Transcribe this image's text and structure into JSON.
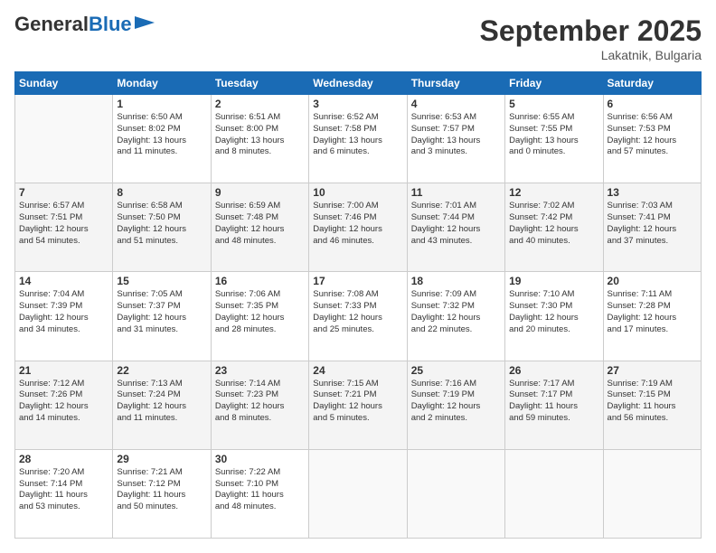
{
  "header": {
    "logo_general": "General",
    "logo_blue": "Blue",
    "month_title": "September 2025",
    "subtitle": "Lakatnik, Bulgaria"
  },
  "weekdays": [
    "Sunday",
    "Monday",
    "Tuesday",
    "Wednesday",
    "Thursday",
    "Friday",
    "Saturday"
  ],
  "weeks": [
    [
      {
        "day": "",
        "info": ""
      },
      {
        "day": "1",
        "info": "Sunrise: 6:50 AM\nSunset: 8:02 PM\nDaylight: 13 hours\nand 11 minutes."
      },
      {
        "day": "2",
        "info": "Sunrise: 6:51 AM\nSunset: 8:00 PM\nDaylight: 13 hours\nand 8 minutes."
      },
      {
        "day": "3",
        "info": "Sunrise: 6:52 AM\nSunset: 7:58 PM\nDaylight: 13 hours\nand 6 minutes."
      },
      {
        "day": "4",
        "info": "Sunrise: 6:53 AM\nSunset: 7:57 PM\nDaylight: 13 hours\nand 3 minutes."
      },
      {
        "day": "5",
        "info": "Sunrise: 6:55 AM\nSunset: 7:55 PM\nDaylight: 13 hours\nand 0 minutes."
      },
      {
        "day": "6",
        "info": "Sunrise: 6:56 AM\nSunset: 7:53 PM\nDaylight: 12 hours\nand 57 minutes."
      }
    ],
    [
      {
        "day": "7",
        "info": "Sunrise: 6:57 AM\nSunset: 7:51 PM\nDaylight: 12 hours\nand 54 minutes."
      },
      {
        "day": "8",
        "info": "Sunrise: 6:58 AM\nSunset: 7:50 PM\nDaylight: 12 hours\nand 51 minutes."
      },
      {
        "day": "9",
        "info": "Sunrise: 6:59 AM\nSunset: 7:48 PM\nDaylight: 12 hours\nand 48 minutes."
      },
      {
        "day": "10",
        "info": "Sunrise: 7:00 AM\nSunset: 7:46 PM\nDaylight: 12 hours\nand 46 minutes."
      },
      {
        "day": "11",
        "info": "Sunrise: 7:01 AM\nSunset: 7:44 PM\nDaylight: 12 hours\nand 43 minutes."
      },
      {
        "day": "12",
        "info": "Sunrise: 7:02 AM\nSunset: 7:42 PM\nDaylight: 12 hours\nand 40 minutes."
      },
      {
        "day": "13",
        "info": "Sunrise: 7:03 AM\nSunset: 7:41 PM\nDaylight: 12 hours\nand 37 minutes."
      }
    ],
    [
      {
        "day": "14",
        "info": "Sunrise: 7:04 AM\nSunset: 7:39 PM\nDaylight: 12 hours\nand 34 minutes."
      },
      {
        "day": "15",
        "info": "Sunrise: 7:05 AM\nSunset: 7:37 PM\nDaylight: 12 hours\nand 31 minutes."
      },
      {
        "day": "16",
        "info": "Sunrise: 7:06 AM\nSunset: 7:35 PM\nDaylight: 12 hours\nand 28 minutes."
      },
      {
        "day": "17",
        "info": "Sunrise: 7:08 AM\nSunset: 7:33 PM\nDaylight: 12 hours\nand 25 minutes."
      },
      {
        "day": "18",
        "info": "Sunrise: 7:09 AM\nSunset: 7:32 PM\nDaylight: 12 hours\nand 22 minutes."
      },
      {
        "day": "19",
        "info": "Sunrise: 7:10 AM\nSunset: 7:30 PM\nDaylight: 12 hours\nand 20 minutes."
      },
      {
        "day": "20",
        "info": "Sunrise: 7:11 AM\nSunset: 7:28 PM\nDaylight: 12 hours\nand 17 minutes."
      }
    ],
    [
      {
        "day": "21",
        "info": "Sunrise: 7:12 AM\nSunset: 7:26 PM\nDaylight: 12 hours\nand 14 minutes."
      },
      {
        "day": "22",
        "info": "Sunrise: 7:13 AM\nSunset: 7:24 PM\nDaylight: 12 hours\nand 11 minutes."
      },
      {
        "day": "23",
        "info": "Sunrise: 7:14 AM\nSunset: 7:23 PM\nDaylight: 12 hours\nand 8 minutes."
      },
      {
        "day": "24",
        "info": "Sunrise: 7:15 AM\nSunset: 7:21 PM\nDaylight: 12 hours\nand 5 minutes."
      },
      {
        "day": "25",
        "info": "Sunrise: 7:16 AM\nSunset: 7:19 PM\nDaylight: 12 hours\nand 2 minutes."
      },
      {
        "day": "26",
        "info": "Sunrise: 7:17 AM\nSunset: 7:17 PM\nDaylight: 11 hours\nand 59 minutes."
      },
      {
        "day": "27",
        "info": "Sunrise: 7:19 AM\nSunset: 7:15 PM\nDaylight: 11 hours\nand 56 minutes."
      }
    ],
    [
      {
        "day": "28",
        "info": "Sunrise: 7:20 AM\nSunset: 7:14 PM\nDaylight: 11 hours\nand 53 minutes."
      },
      {
        "day": "29",
        "info": "Sunrise: 7:21 AM\nSunset: 7:12 PM\nDaylight: 11 hours\nand 50 minutes."
      },
      {
        "day": "30",
        "info": "Sunrise: 7:22 AM\nSunset: 7:10 PM\nDaylight: 11 hours\nand 48 minutes."
      },
      {
        "day": "",
        "info": ""
      },
      {
        "day": "",
        "info": ""
      },
      {
        "day": "",
        "info": ""
      },
      {
        "day": "",
        "info": ""
      }
    ]
  ]
}
